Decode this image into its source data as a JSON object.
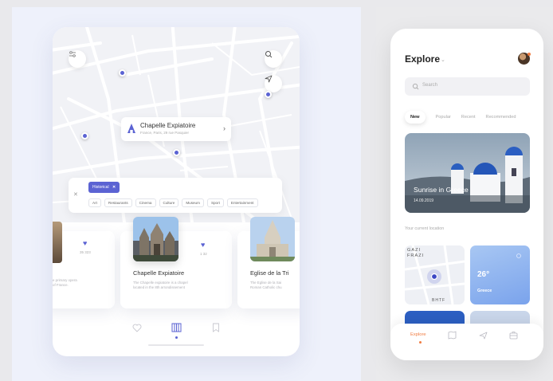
{
  "colors": {
    "accent": "#5b63d3",
    "orange": "#f07d42"
  },
  "map": {
    "filter_icon": "filter-icon",
    "search_icon": "search-icon",
    "locate_icon": "navigation-arrow-icon",
    "poi": {
      "title": "Chapelle Expiatoire",
      "subtitle": "France, Paris, 29 rue Pasquier"
    }
  },
  "filters": {
    "active_chip": "Historical",
    "chips": [
      "Art",
      "Restaurants",
      "Cinema",
      "Culture",
      "Museum",
      "Sport",
      "Entertainment"
    ]
  },
  "places": [
    {
      "count": "35 323",
      "title": "",
      "desc": "e primary opera\nof France."
    },
    {
      "count": "1 32",
      "title": "Chapelle Expiatoire",
      "desc": "The Chapelle expiatoire is a chapel\nlocated in the 8th arrondissement"
    },
    {
      "count": "",
      "title": "Eglise de la Tri",
      "desc": "The Eglise de la Sai\nRoman Catholic chu"
    }
  ],
  "explore": {
    "title": "Explore",
    "search_placeholder": "Search",
    "tabs": [
      "New",
      "Popular",
      "Recent",
      "Recommended"
    ],
    "hero": {
      "title": "Sunrise in Greece",
      "date": "14.09.2019"
    },
    "location_label": "Your current location",
    "map_labels": [
      "GAZI",
      "FRAZI",
      "BHTF"
    ],
    "weather": {
      "temp": "26°",
      "place": "Greece"
    },
    "nav_label": "Explore"
  }
}
